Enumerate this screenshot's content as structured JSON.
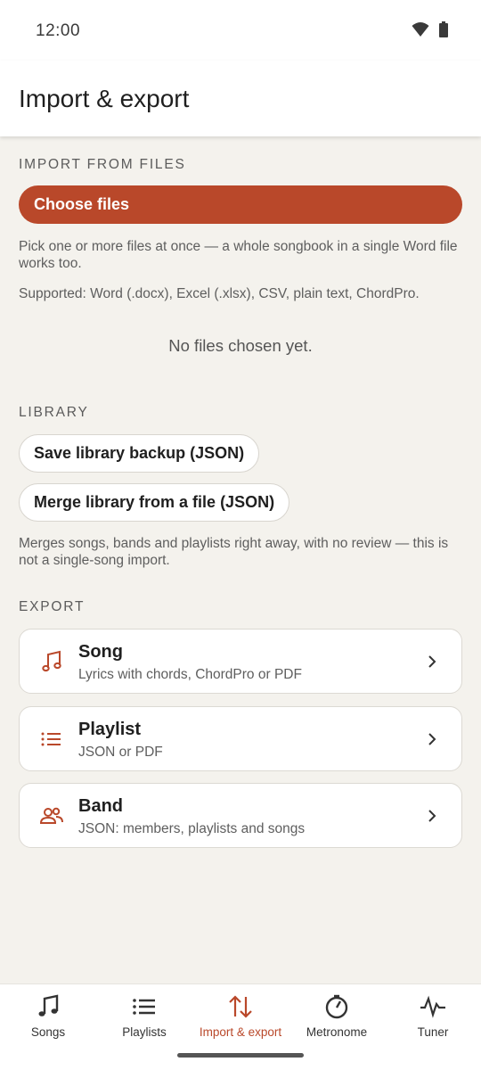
{
  "status_bar": {
    "time": "12:00",
    "icons": [
      "wifi-icon",
      "battery-icon"
    ]
  },
  "app_bar": {
    "title": "Import & export"
  },
  "import_section": {
    "label": "IMPORT FROM FILES",
    "choose_button": "Choose files",
    "help_text": "Pick one or more files at once — a whole songbook in a single Word file works too.",
    "supported_text": "Supported: Word (.docx), Excel (.xlsx), CSV, plain text, ChordPro.",
    "empty_state": "No files chosen yet."
  },
  "library_section": {
    "label": "LIBRARY",
    "backup_button": "Save library backup (JSON)",
    "merge_button": "Merge library from a file (JSON)",
    "note": "Merges songs, bands and playlists right away, with no review — this is not a single-song import."
  },
  "export_section": {
    "label": "EXPORT",
    "items": [
      {
        "icon": "music-note-icon",
        "title": "Song",
        "subtitle": "Lyrics with chords, ChordPro or PDF"
      },
      {
        "icon": "list-icon",
        "title": "Playlist",
        "subtitle": "JSON or PDF"
      },
      {
        "icon": "people-icon",
        "title": "Band",
        "subtitle": "JSON: members, playlists and songs"
      }
    ]
  },
  "bottom_nav": {
    "active": "Import & export",
    "items": [
      {
        "icon": "music-note-icon",
        "label": "Songs"
      },
      {
        "icon": "list-icon",
        "label": "Playlists"
      },
      {
        "icon": "import-export-icon",
        "label": "Import & export"
      },
      {
        "icon": "metronome-icon",
        "label": "Metronome"
      },
      {
        "icon": "tuner-wave-icon",
        "label": "Tuner"
      }
    ]
  },
  "colors": {
    "accent": "#b9482a",
    "background": "#f4f2ed",
    "surface": "#ffffff"
  }
}
